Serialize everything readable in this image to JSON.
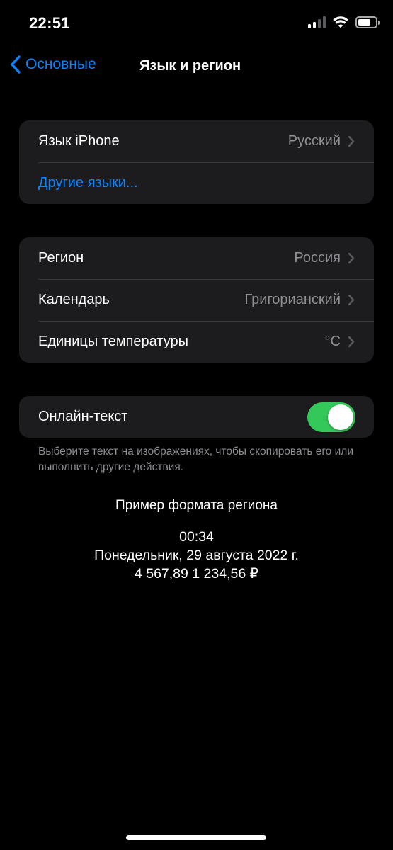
{
  "status_bar": {
    "time": "22:51",
    "signal_icon": "cellular-signal-icon",
    "wifi_icon": "wifi-icon",
    "battery_icon": "battery-icon",
    "battery_level": 0.75
  },
  "nav": {
    "back_label": "Основные",
    "back_icon": "chevron-left-icon",
    "title": "Язык и регион"
  },
  "language_group": {
    "iphone_language": {
      "label": "Язык iPhone",
      "value": "Русский"
    },
    "other_languages": {
      "label": "Другие языки..."
    }
  },
  "region_group": {
    "region": {
      "label": "Регион",
      "value": "Россия"
    },
    "calendar": {
      "label": "Календарь",
      "value": "Григорианский"
    },
    "temperature": {
      "label": "Единицы температуры",
      "value": "°C"
    }
  },
  "live_text": {
    "label": "Онлайн-текст",
    "enabled": true,
    "footnote": "Выберите текст на изображениях, чтобы скопировать его или выполнить другие действия."
  },
  "region_sample": {
    "title": "Пример формата региона",
    "time": "00:34",
    "date": "Понедельник, 29 августа 2022 г.",
    "numbers": "4 567,89 1 234,56 ₽"
  },
  "colors": {
    "accent": "#0a84ff",
    "toggle_on": "#34c759",
    "cell_background": "#1c1c1e",
    "secondary_text": "#8e8e93"
  }
}
